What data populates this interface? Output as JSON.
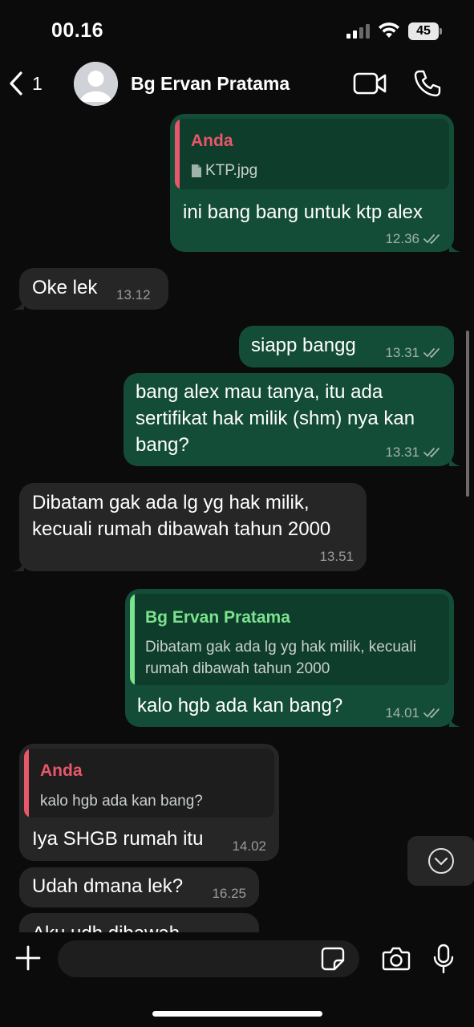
{
  "status": {
    "time": "00.16",
    "battery": "45"
  },
  "header": {
    "back_count": "1",
    "contact_name": "Bg Ervan Pratama"
  },
  "colors": {
    "outgoing_bubble": "#144d37",
    "incoming_bubble": "#262626",
    "quote_author_self": "#e8576a",
    "quote_author_contact": "#7be38e"
  },
  "messages": [
    {
      "direction": "out",
      "quote_author": "Anda",
      "quote_file": "KTP.jpg",
      "text": "ini bang bang untuk ktp alex",
      "time": "12.36"
    },
    {
      "direction": "in",
      "text": "Oke lek",
      "time": "13.12"
    },
    {
      "direction": "out",
      "text": "siapp bangg",
      "time": "13.31"
    },
    {
      "direction": "out",
      "text_lines": [
        "bang alex mau tanya, itu ada",
        "sertifikat hak milik (shm) nya kan",
        "bang?"
      ],
      "time": "13.31"
    },
    {
      "direction": "in",
      "text_lines": [
        "Dibatam gak ada lg yg hak milik,",
        "kecuali rumah dibawah tahun 2000"
      ],
      "time": "13.51"
    },
    {
      "direction": "out",
      "quote_author": "Bg Ervan Pratama",
      "quote_text_lines": [
        "Dibatam gak ada lg yg hak milik, kecuali",
        "rumah dibawah tahun 2000"
      ],
      "text": "kalo hgb ada kan bang?",
      "time": "14.01"
    },
    {
      "direction": "in",
      "quote_author": "Anda",
      "quote_text": "kalo hgb ada kan bang?",
      "text": "Iya SHGB rumah itu",
      "time": "14.02"
    },
    {
      "direction": "in",
      "text": "Udah dmana lek?",
      "time": "16.25"
    },
    {
      "direction": "in",
      "text": "Aku udh dibawah"
    }
  ],
  "input": {
    "placeholder": ""
  }
}
